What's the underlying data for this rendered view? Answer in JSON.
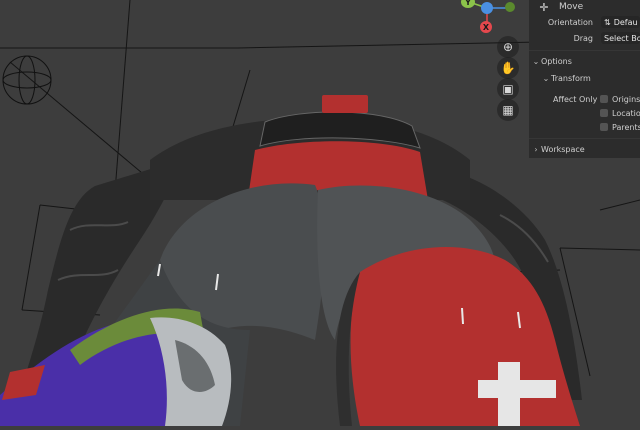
{
  "gizmo": {
    "axis_y_label": "Y",
    "axis_x_label": "X",
    "colors": {
      "x": "#e5484d",
      "y": "#8bc34a",
      "z": "#4a90e2"
    }
  },
  "navigation": {
    "zoom_icon": "magnifier-plus-icon",
    "pan_icon": "hand-icon",
    "camera_icon": "camera-icon",
    "grid_icon": "grid-icon"
  },
  "tool_settings": {
    "move_label": "Move",
    "orientation_label": "Orientation",
    "orientation_value": "Defau",
    "drag_label": "Drag",
    "drag_value": "Select Bo",
    "options_label": "Options",
    "transform_label": "Transform",
    "affect_only_label": "Affect Only",
    "affect_items": [
      "Origins",
      "Locatio",
      "Parents"
    ],
    "workspace_label": "Workspace"
  },
  "colors": {
    "viewport_bg": "#3d3d3d",
    "panel_bg": "#2c2c2c",
    "mesh_dark": "#262626",
    "mesh_grey": "#4a4d4f",
    "accent_red": "#b3302f",
    "purple": "#4a2fa8"
  }
}
